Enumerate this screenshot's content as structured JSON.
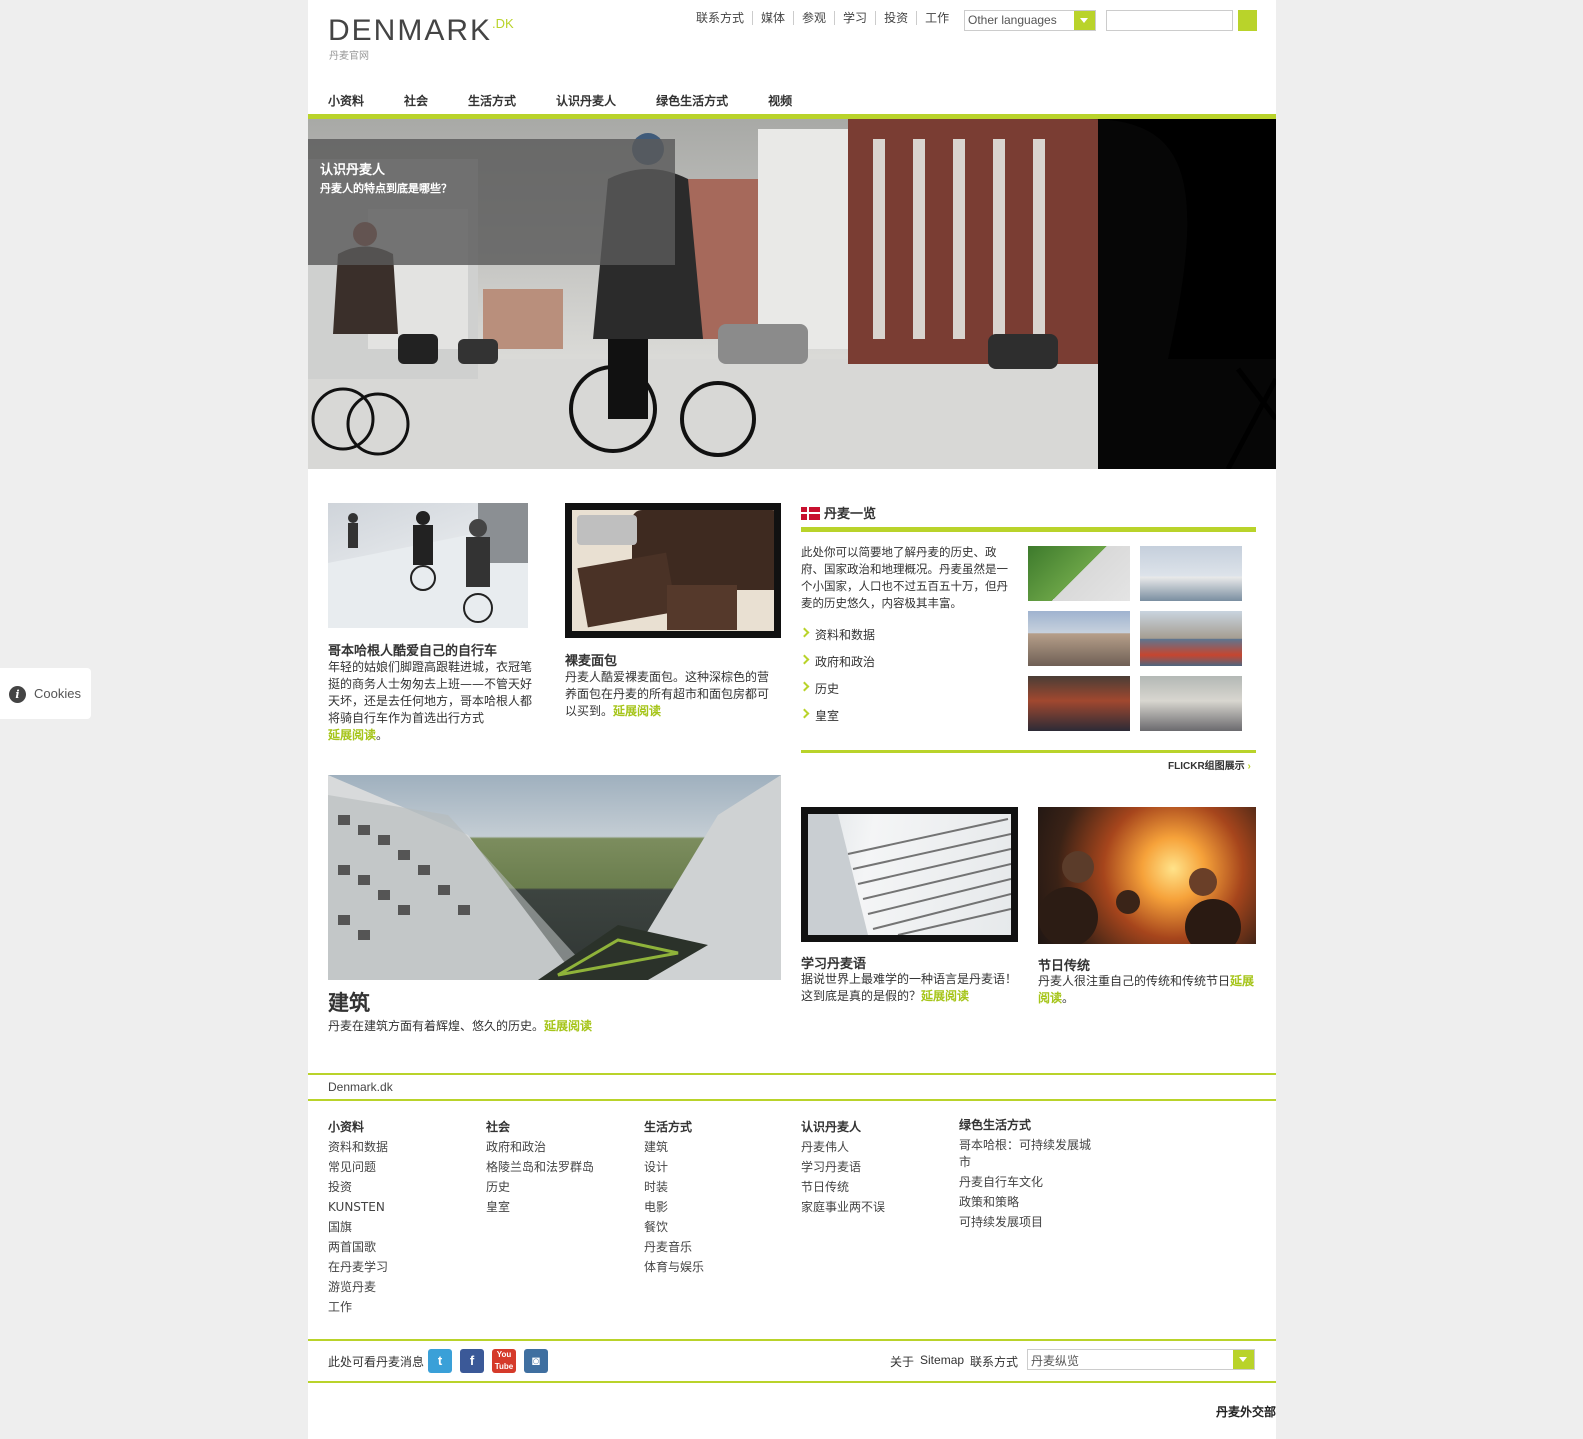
{
  "header": {
    "logo_main": "DENMARK",
    "logo_suffix": ".DK",
    "logo_sub": "丹麦官网",
    "top_links": [
      "联系方式",
      "媒体",
      "参观",
      "学习",
      "投资",
      "工作"
    ],
    "language_select": "Other languages"
  },
  "nav": [
    "小资料",
    "社会",
    "生活方式",
    "认识丹麦人",
    "绿色生活方式",
    "视频"
  ],
  "hero": {
    "title": "认识丹麦人",
    "subtitle": "丹麦人的特点到底是哪些？"
  },
  "articles": {
    "bike": {
      "title": "哥本哈根人酷爱自己的自行车",
      "text": "年轻的姑娘们脚蹬高跟鞋进城，衣冠笔挺的商务人士匆匆去上班——不管天好天坏，还是去任何地方，哥本哈根人都将骑自行车作为首选出行方式",
      "more": "延展阅读",
      "end": "。"
    },
    "bread": {
      "title": "裸麦面包",
      "text": "丹麦人酷爱裸麦面包。这种深棕色的营养面包在丹麦的所有超市和面包房都可以买到。",
      "more": "延展阅读"
    },
    "architecture": {
      "title": "建筑",
      "text": "丹麦在建筑方面有着辉煌、悠久的历史。",
      "more": "延展阅读"
    },
    "language": {
      "title": "学习丹麦语",
      "text": "据说世界上最难学的一种语言是丹麦语！这到底是真的是假的？",
      "more": "延展阅读"
    },
    "holidays": {
      "title": "节日传统",
      "text": "丹麦人很注重自己的传统和传统节日",
      "more": "延展阅读",
      "end": "。"
    }
  },
  "overview": {
    "title": "丹麦一览",
    "text": "此处你可以简要地了解丹麦的历史、政府、国家政治和地理概况。丹麦虽然是一个小国家，人口也不过五百五十万，但丹麦的历史悠久，内容极其丰富。",
    "links": [
      "资料和数据",
      "政府和政治",
      "历史",
      "皇室"
    ],
    "flickr": "FLICKR组图展示"
  },
  "footer": {
    "site": "Denmark.dk",
    "columns": [
      {
        "title": "小资料",
        "items": [
          "资料和数据",
          "常见问题",
          "投资",
          "KUNSTEN",
          "国旗",
          "两首国歌",
          "在丹麦学习",
          "游览丹麦",
          "工作"
        ]
      },
      {
        "title": "社会",
        "items": [
          "政府和政治",
          "格陵兰岛和法罗群岛",
          "历史",
          "皇室"
        ]
      },
      {
        "title": "生活方式",
        "items": [
          "建筑",
          "设计",
          "时装",
          "电影",
          "餐饮",
          "丹麦音乐",
          "体育与娱乐"
        ]
      },
      {
        "title": "认识丹麦人",
        "items": [
          "丹麦伟人",
          "学习丹麦语",
          "节日传统",
          "家庭事业两不误"
        ]
      },
      {
        "title": "绿色生活方式",
        "items": [
          "哥本哈根：可持续发展城市",
          "丹麦自行车文化",
          "政策和策略",
          "可持续发展项目"
        ]
      }
    ],
    "social_label": "此处可看丹麦消息",
    "social_icons": [
      "twitter-icon",
      "facebook-icon",
      "youtube-icon",
      "instagram-icon"
    ],
    "links": [
      "关于",
      "Sitemap",
      "联系方式"
    ],
    "dropdown": "丹麦纵览",
    "ministry": "丹麦外交部"
  },
  "cookies": "Cookies",
  "colors": {
    "accent": "#b9d32a",
    "link": "#a6c51a"
  }
}
